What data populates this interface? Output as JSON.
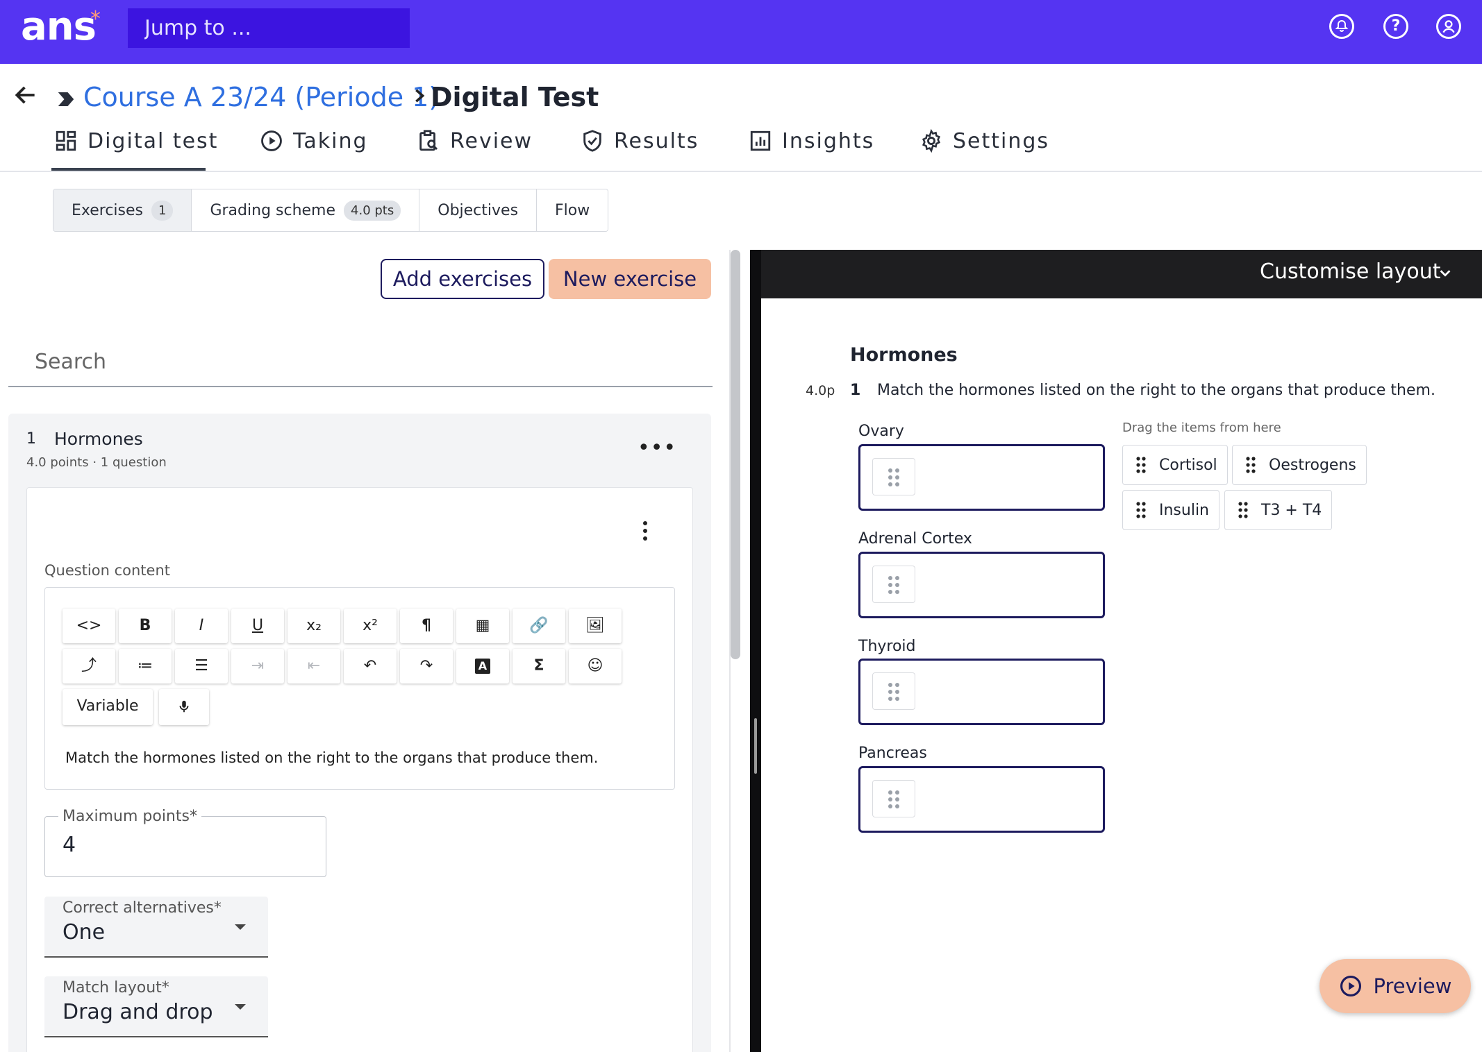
{
  "topbar": {
    "logo": "ans",
    "logo_mark": "*",
    "jump_placeholder": "Jump to ...",
    "icons": [
      "notification-icon",
      "help-icon",
      "account-icon"
    ]
  },
  "breadcrumb": {
    "course": "Course A 23/24 (Periode 1)",
    "separator": ">",
    "current": "Digital Test"
  },
  "tabs": [
    {
      "label": "Digital test",
      "icon": "dashboard-icon",
      "active": true
    },
    {
      "label": "Taking",
      "icon": "play-circle-icon"
    },
    {
      "label": "Review",
      "icon": "clipboard-search-icon"
    },
    {
      "label": "Results",
      "icon": "shield-check-icon"
    },
    {
      "label": "Insights",
      "icon": "bar-chart-icon"
    },
    {
      "label": "Settings",
      "icon": "gear-icon"
    }
  ],
  "subtabs": [
    {
      "label": "Exercises",
      "badge": "1",
      "active": true
    },
    {
      "label": "Grading scheme",
      "badge": "4.0 pts"
    },
    {
      "label": "Objectives"
    },
    {
      "label": "Flow"
    }
  ],
  "actions": {
    "add": "Add exercises",
    "new": "New exercise"
  },
  "search": {
    "placeholder": "Search"
  },
  "exercise": {
    "number": "1",
    "title": "Hormones",
    "meta": "4.0 points · 1 question",
    "more": "•••"
  },
  "question": {
    "content_label": "Question content",
    "toolbar_row1": [
      "<>",
      "B",
      "I",
      "U",
      "x₂",
      "x²",
      "¶",
      "▦",
      "🔗",
      "🖼"
    ],
    "toolbar_row2": [
      "⤴",
      "≔",
      "☰",
      "⇥",
      "⇤",
      "↶",
      "↷",
      "A",
      "Σ",
      "☺"
    ],
    "variable": "Variable",
    "mic": "🎤",
    "text": "Match the hormones listed on the right to the organs that produce them.",
    "max_points_label": "Maximum points*",
    "max_points_value": "4",
    "correct_alt_label": "Correct alternatives*",
    "correct_alt_value": "One",
    "match_layout_label": "Match layout*",
    "match_layout_value": "Drag and drop"
  },
  "preview": {
    "header": "Customise layout",
    "title": "Hormones",
    "points": "4.0p",
    "qnum": "1",
    "qtext": "Match the hormones listed on the right to the organs that produce them.",
    "targets": [
      "Ovary",
      "Adrenal Cortex",
      "Thyroid",
      "Pancreas"
    ],
    "drag_hint": "Drag the items from here",
    "chips": [
      "Cortisol",
      "Oestrogens",
      "Insulin",
      "T3 + T4"
    ],
    "preview_button": "Preview"
  }
}
